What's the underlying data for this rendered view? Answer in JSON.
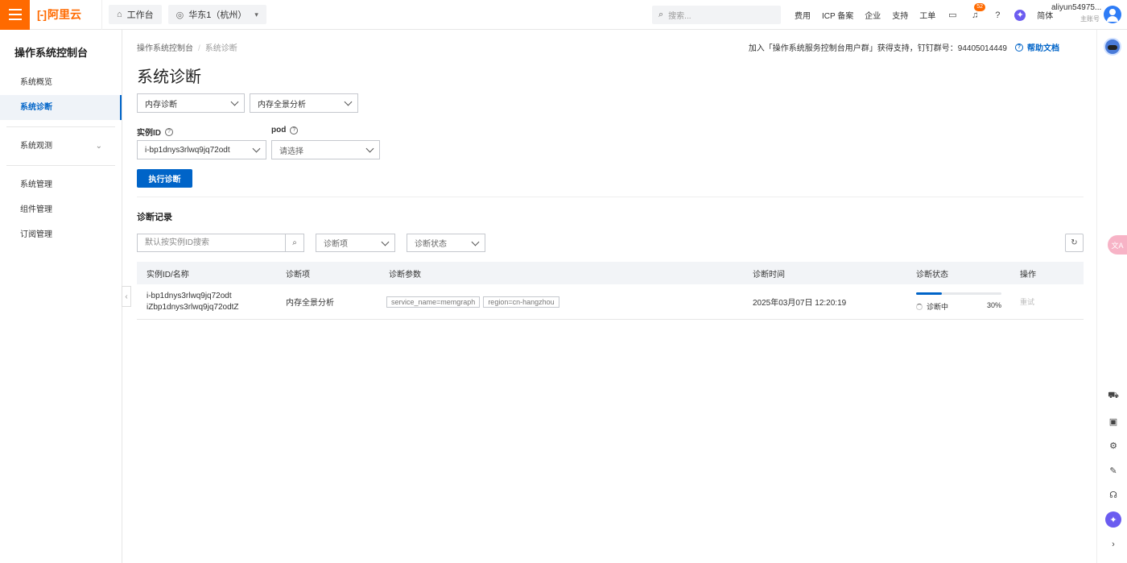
{
  "topbar": {
    "logo_mark": "[-]",
    "logo_text": "阿里云",
    "workbench": "工作台",
    "region": "华东1（杭州）",
    "search_placeholder": "搜索...",
    "links": [
      "费用",
      "ICP 备案",
      "企业",
      "支持",
      "工单"
    ],
    "notification_count": "52",
    "lang": "简体",
    "user_name": "aliyun54975...",
    "user_sub": "主账号"
  },
  "sidebar": {
    "title": "操作系统控制台",
    "items": [
      {
        "label": "系统概览"
      },
      {
        "label": "系统诊断"
      },
      {
        "label": "系统观测"
      },
      {
        "label": "系统管理"
      },
      {
        "label": "组件管理"
      },
      {
        "label": "订阅管理"
      }
    ]
  },
  "main": {
    "breadcrumb": [
      "操作系统控制台",
      "系统诊断"
    ],
    "notice": "加入「操作系统服务控制台用户群」获得支持，钉钉群号：94405014449",
    "help": "帮助文档",
    "title": "系统诊断",
    "diag_type": "内存诊断",
    "diag_item": "内存全景分析",
    "instance_label": "实例ID",
    "instance_value": "i-bp1dnys3rlwq9jq72odt",
    "pod_label": "pod",
    "pod_placeholder": "请选择",
    "run_button": "执行诊断",
    "records_title": "诊断记录",
    "record_search_placeholder": "默认按实例ID搜索",
    "filter_item": "诊断项",
    "filter_status": "诊断状态"
  },
  "table": {
    "headers": [
      "实例ID/名称",
      "诊断项",
      "诊断参数",
      "诊断时间",
      "诊断状态",
      "操作"
    ],
    "rows": [
      {
        "instance_id": "i-bp1dnys3rlwq9jq72odt",
        "instance_name": "iZbp1dnys3rlwq9jq72odtZ",
        "item": "内存全景分析",
        "params": [
          "service_name=memgraph",
          "region=cn-hangzhou"
        ],
        "time": "2025年03月07日 12:20:19",
        "status": "诊断中",
        "progress": "30%",
        "progress_value": 0.3,
        "action": "重试"
      }
    ]
  },
  "colors": {
    "brand": "#ff6a00",
    "primary": "#0064c8"
  }
}
